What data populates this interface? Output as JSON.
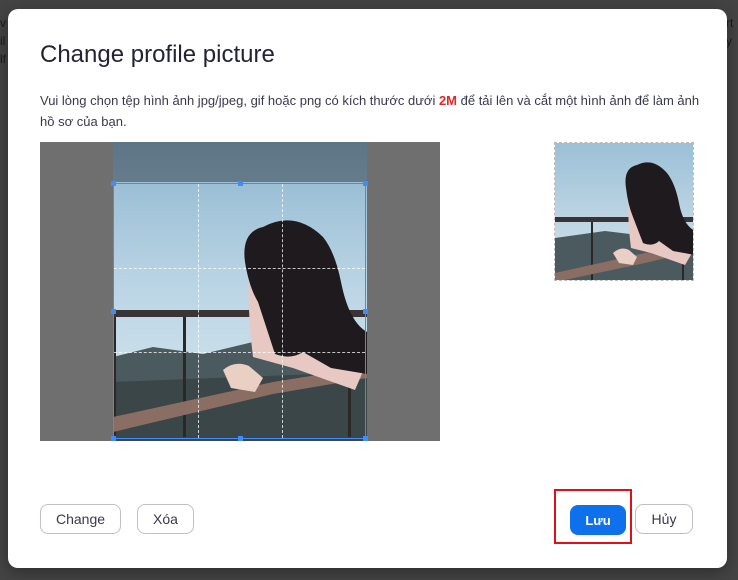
{
  "background": {
    "left_fragments": [
      "v",
      "il",
      "lf"
    ],
    "right_fragments": [
      "rt",
      "y",
      ""
    ]
  },
  "dialog": {
    "title": "Change profile picture",
    "description_before": "Vui lòng chọn tệp hình ảnh jpg/jpeg, gif hoặc png có kích thước dưới ",
    "description_highlight": "2M",
    "description_after": " để tải lên và cắt một hình ảnh để làm ảnh hồ sơ của bạn.",
    "highlight_color": "#e02828"
  },
  "buttons": {
    "change": "Change",
    "delete": "Xóa",
    "save": "Lưu",
    "cancel": "Hủy"
  },
  "colors": {
    "primary": "#0e71eb",
    "crop_border": "#3f8cff",
    "annotation": "#e0101a"
  }
}
